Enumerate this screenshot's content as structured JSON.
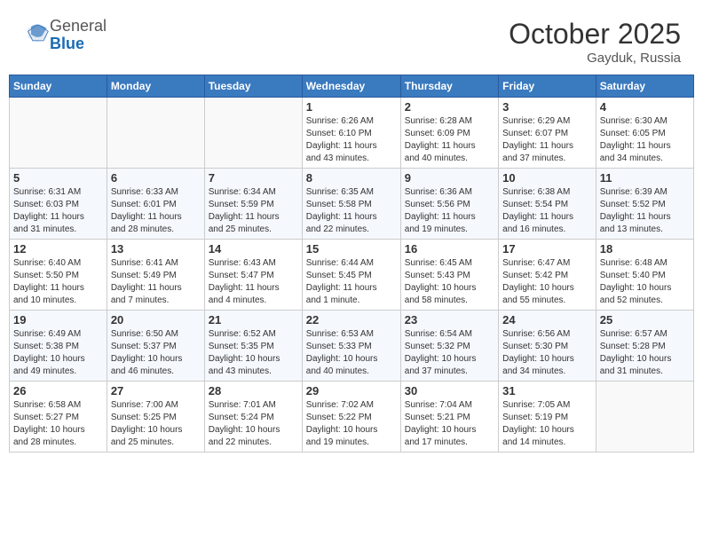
{
  "header": {
    "logo_general": "General",
    "logo_blue": "Blue",
    "month": "October 2025",
    "location": "Gayduk, Russia"
  },
  "weekdays": [
    "Sunday",
    "Monday",
    "Tuesday",
    "Wednesday",
    "Thursday",
    "Friday",
    "Saturday"
  ],
  "weeks": [
    [
      {
        "day": "",
        "info": ""
      },
      {
        "day": "",
        "info": ""
      },
      {
        "day": "",
        "info": ""
      },
      {
        "day": "1",
        "info": "Sunrise: 6:26 AM\nSunset: 6:10 PM\nDaylight: 11 hours\nand 43 minutes."
      },
      {
        "day": "2",
        "info": "Sunrise: 6:28 AM\nSunset: 6:09 PM\nDaylight: 11 hours\nand 40 minutes."
      },
      {
        "day": "3",
        "info": "Sunrise: 6:29 AM\nSunset: 6:07 PM\nDaylight: 11 hours\nand 37 minutes."
      },
      {
        "day": "4",
        "info": "Sunrise: 6:30 AM\nSunset: 6:05 PM\nDaylight: 11 hours\nand 34 minutes."
      }
    ],
    [
      {
        "day": "5",
        "info": "Sunrise: 6:31 AM\nSunset: 6:03 PM\nDaylight: 11 hours\nand 31 minutes."
      },
      {
        "day": "6",
        "info": "Sunrise: 6:33 AM\nSunset: 6:01 PM\nDaylight: 11 hours\nand 28 minutes."
      },
      {
        "day": "7",
        "info": "Sunrise: 6:34 AM\nSunset: 5:59 PM\nDaylight: 11 hours\nand 25 minutes."
      },
      {
        "day": "8",
        "info": "Sunrise: 6:35 AM\nSunset: 5:58 PM\nDaylight: 11 hours\nand 22 minutes."
      },
      {
        "day": "9",
        "info": "Sunrise: 6:36 AM\nSunset: 5:56 PM\nDaylight: 11 hours\nand 19 minutes."
      },
      {
        "day": "10",
        "info": "Sunrise: 6:38 AM\nSunset: 5:54 PM\nDaylight: 11 hours\nand 16 minutes."
      },
      {
        "day": "11",
        "info": "Sunrise: 6:39 AM\nSunset: 5:52 PM\nDaylight: 11 hours\nand 13 minutes."
      }
    ],
    [
      {
        "day": "12",
        "info": "Sunrise: 6:40 AM\nSunset: 5:50 PM\nDaylight: 11 hours\nand 10 minutes."
      },
      {
        "day": "13",
        "info": "Sunrise: 6:41 AM\nSunset: 5:49 PM\nDaylight: 11 hours\nand 7 minutes."
      },
      {
        "day": "14",
        "info": "Sunrise: 6:43 AM\nSunset: 5:47 PM\nDaylight: 11 hours\nand 4 minutes."
      },
      {
        "day": "15",
        "info": "Sunrise: 6:44 AM\nSunset: 5:45 PM\nDaylight: 11 hours\nand 1 minute."
      },
      {
        "day": "16",
        "info": "Sunrise: 6:45 AM\nSunset: 5:43 PM\nDaylight: 10 hours\nand 58 minutes."
      },
      {
        "day": "17",
        "info": "Sunrise: 6:47 AM\nSunset: 5:42 PM\nDaylight: 10 hours\nand 55 minutes."
      },
      {
        "day": "18",
        "info": "Sunrise: 6:48 AM\nSunset: 5:40 PM\nDaylight: 10 hours\nand 52 minutes."
      }
    ],
    [
      {
        "day": "19",
        "info": "Sunrise: 6:49 AM\nSunset: 5:38 PM\nDaylight: 10 hours\nand 49 minutes."
      },
      {
        "day": "20",
        "info": "Sunrise: 6:50 AM\nSunset: 5:37 PM\nDaylight: 10 hours\nand 46 minutes."
      },
      {
        "day": "21",
        "info": "Sunrise: 6:52 AM\nSunset: 5:35 PM\nDaylight: 10 hours\nand 43 minutes."
      },
      {
        "day": "22",
        "info": "Sunrise: 6:53 AM\nSunset: 5:33 PM\nDaylight: 10 hours\nand 40 minutes."
      },
      {
        "day": "23",
        "info": "Sunrise: 6:54 AM\nSunset: 5:32 PM\nDaylight: 10 hours\nand 37 minutes."
      },
      {
        "day": "24",
        "info": "Sunrise: 6:56 AM\nSunset: 5:30 PM\nDaylight: 10 hours\nand 34 minutes."
      },
      {
        "day": "25",
        "info": "Sunrise: 6:57 AM\nSunset: 5:28 PM\nDaylight: 10 hours\nand 31 minutes."
      }
    ],
    [
      {
        "day": "26",
        "info": "Sunrise: 6:58 AM\nSunset: 5:27 PM\nDaylight: 10 hours\nand 28 minutes."
      },
      {
        "day": "27",
        "info": "Sunrise: 7:00 AM\nSunset: 5:25 PM\nDaylight: 10 hours\nand 25 minutes."
      },
      {
        "day": "28",
        "info": "Sunrise: 7:01 AM\nSunset: 5:24 PM\nDaylight: 10 hours\nand 22 minutes."
      },
      {
        "day": "29",
        "info": "Sunrise: 7:02 AM\nSunset: 5:22 PM\nDaylight: 10 hours\nand 19 minutes."
      },
      {
        "day": "30",
        "info": "Sunrise: 7:04 AM\nSunset: 5:21 PM\nDaylight: 10 hours\nand 17 minutes."
      },
      {
        "day": "31",
        "info": "Sunrise: 7:05 AM\nSunset: 5:19 PM\nDaylight: 10 hours\nand 14 minutes."
      },
      {
        "day": "",
        "info": ""
      }
    ]
  ]
}
